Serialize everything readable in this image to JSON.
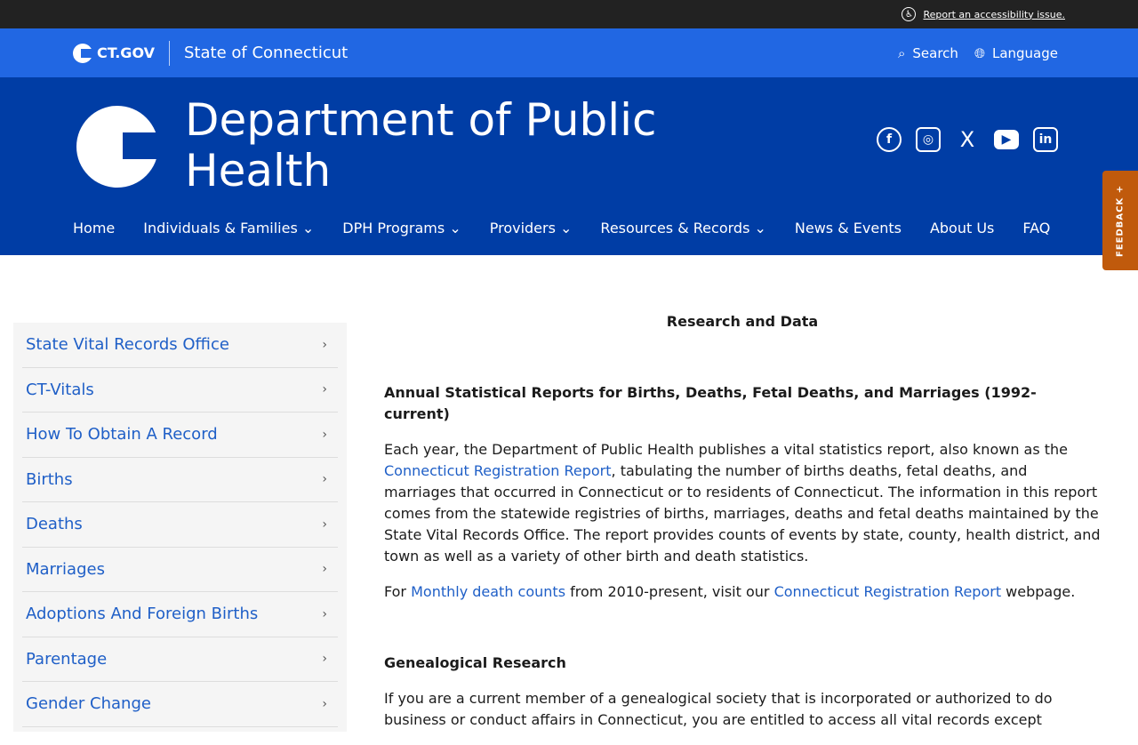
{
  "topbar": {
    "accessibility_link": "Report an accessibility issue."
  },
  "ctbar": {
    "logo": "CT.GOV",
    "state": "State of Connecticut",
    "search": "Search",
    "language": "Language"
  },
  "header": {
    "title": "Department of Public Health"
  },
  "social": [
    "f",
    "◎",
    "X",
    "▶",
    "in"
  ],
  "nav": [
    "Home",
    "Individuals & Families ⌄",
    "DPH Programs ⌄",
    "Providers ⌄",
    "Resources & Records ⌄",
    "News & Events",
    "About Us",
    "FAQ"
  ],
  "feedback": "FEEDBACK +",
  "sidebar": [
    "State Vital Records Office",
    "CT-Vitals",
    "How To Obtain A Record",
    "Births",
    "Deaths",
    "Marriages",
    "Adoptions And Foreign Births",
    "Parentage",
    "Gender Change"
  ],
  "main": {
    "heading": "Research and Data",
    "section1_title": "Annual Statistical Reports for Births, Deaths, Fetal Deaths, and Marriages (1992-current)",
    "p1_a": "Each year, the Department of Public Health publishes a vital statistics report, also known as the ",
    "p1_link": "Connecticut Registration Report",
    "p1_b": ", tabulating the number of births deaths, fetal deaths, and marriages that occurred in Connecticut or to residents of Connecticut.  The information in this report comes from the statewide registries of births, marriages, deaths and fetal deaths maintained by the State Vital Records Office. The report provides counts of events by state, county, health district, and town as well as a variety of other birth and death statistics.",
    "p2_a": "For ",
    "p2_link1": "Monthly death counts",
    "p2_b": " from 2010-present, visit our ",
    "p2_link2": "Connecticut Registration Report",
    "p2_c": " webpage.",
    "section2_title": "Genealogical Research",
    "p3": "If you are a current member of a genealogical society that is incorporated or authorized to do business or conduct affairs in Connecticut, you are entitled to access all vital records except"
  }
}
